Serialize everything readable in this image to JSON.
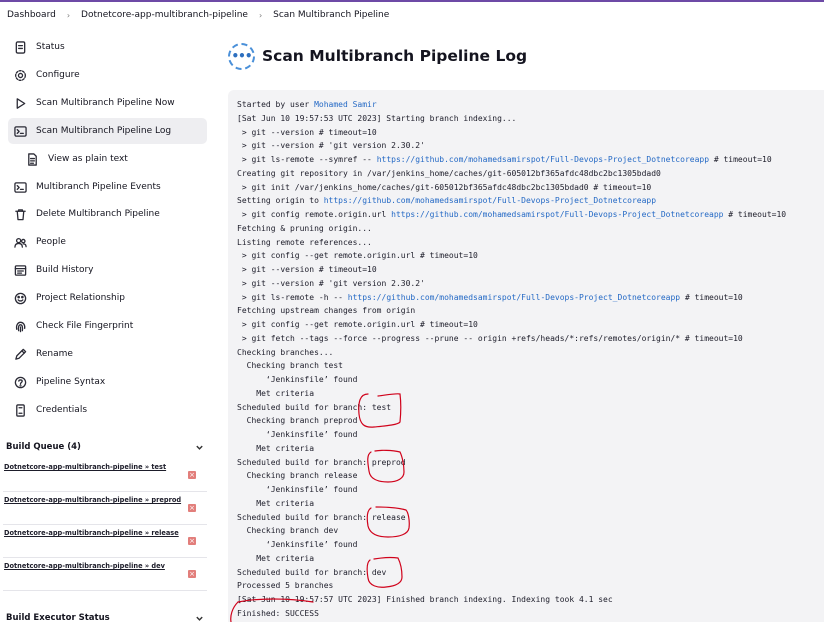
{
  "breadcrumb": [
    "Dashboard",
    "Dotnetcore-app-multibranch-pipeline",
    "Scan Multibranch Pipeline"
  ],
  "sidebar": {
    "tasks": [
      {
        "label": "Status",
        "icon": "notepad-icon"
      },
      {
        "label": "Configure",
        "icon": "gear-icon"
      },
      {
        "label": "Scan Multibranch Pipeline Now",
        "icon": "play-icon"
      },
      {
        "label": "Scan Multibranch Pipeline Log",
        "icon": "terminal-icon"
      },
      {
        "label": "View as plain text",
        "icon": "document-icon"
      },
      {
        "label": "Multibranch Pipeline Events",
        "icon": "terminal-icon"
      },
      {
        "label": "Delete Multibranch Pipeline",
        "icon": "trash-icon"
      },
      {
        "label": "People",
        "icon": "people-icon"
      },
      {
        "label": "Build History",
        "icon": "history-icon"
      },
      {
        "label": "Project Relationship",
        "icon": "relationship-icon"
      },
      {
        "label": "Check File Fingerprint",
        "icon": "fingerprint-icon"
      },
      {
        "label": "Rename",
        "icon": "pencil-icon"
      },
      {
        "label": "Pipeline Syntax",
        "icon": "help-icon"
      },
      {
        "label": "Credentials",
        "icon": "credentials-icon"
      }
    ],
    "build_queue": {
      "title": "Build Queue (4)",
      "items": [
        "Dotnetcore-app-multibranch-pipeline » test",
        "Dotnetcore-app-multibranch-pipeline » preprod",
        "Dotnetcore-app-multibranch-pipeline » release",
        "Dotnetcore-app-multibranch-pipeline » dev"
      ]
    },
    "executor_title": "Build Executor Status"
  },
  "page": {
    "title": "Scan Multibranch Pipeline Log"
  },
  "log": {
    "started_prefix": "Started by user ",
    "started_user": "Mohamed Samir",
    "repo_url": "https://github.com/mohamedsamirspot/Full-Devops-Project_Dotnetcoreapp",
    "lines": [
      "[Sat Jun 10 19:57:53 UTC 2023] Starting branch indexing...",
      " > git --version # timeout=10",
      " > git --version # 'git version 2.30.2'",
      [
        " > git ls-remote --symref -- ",
        "url",
        " # timeout=10"
      ],
      "Creating git repository in /var/jenkins_home/caches/git-605012bf365afdc48dbc2bc1305bdad0",
      " > git init /var/jenkins_home/caches/git-605012bf365afdc48dbc2bc1305bdad0 # timeout=10",
      [
        "Setting origin to ",
        "url",
        ""
      ],
      [
        " > git config remote.origin.url ",
        "url",
        " # timeout=10"
      ],
      "Fetching & pruning origin...",
      "Listing remote references...",
      " > git config --get remote.origin.url # timeout=10",
      " > git --version # timeout=10",
      " > git --version # 'git version 2.30.2'",
      [
        " > git ls-remote -h -- ",
        "url",
        " # timeout=10"
      ],
      "Fetching upstream changes from origin",
      " > git config --get remote.origin.url # timeout=10",
      " > git fetch --tags --force --progress --prune -- origin +refs/heads/*:refs/remotes/origin/* # timeout=10",
      "Checking branches...",
      "  Checking branch test",
      "      ‘Jenkinsfile’ found",
      "    Met criteria",
      "Scheduled build for branch: test",
      "  Checking branch preprod",
      "      ‘Jenkinsfile’ found",
      "    Met criteria",
      "Scheduled build for branch: preprod",
      "  Checking branch release",
      "      ‘Jenkinsfile’ found",
      "    Met criteria",
      "Scheduled build for branch: release",
      "  Checking branch dev",
      "      ‘Jenkinsfile’ found",
      "    Met criteria",
      "Scheduled build for branch: dev",
      "Processed 5 branches",
      "[Sat Jun 10 19:57:57 UTC 2023] Finished branch indexing. Indexing took 4.1 sec",
      "Finished: SUCCESS"
    ]
  },
  "colors": {
    "link": "#2469c5",
    "annotation": "#d0021b",
    "accent": "#6d4aa6"
  }
}
